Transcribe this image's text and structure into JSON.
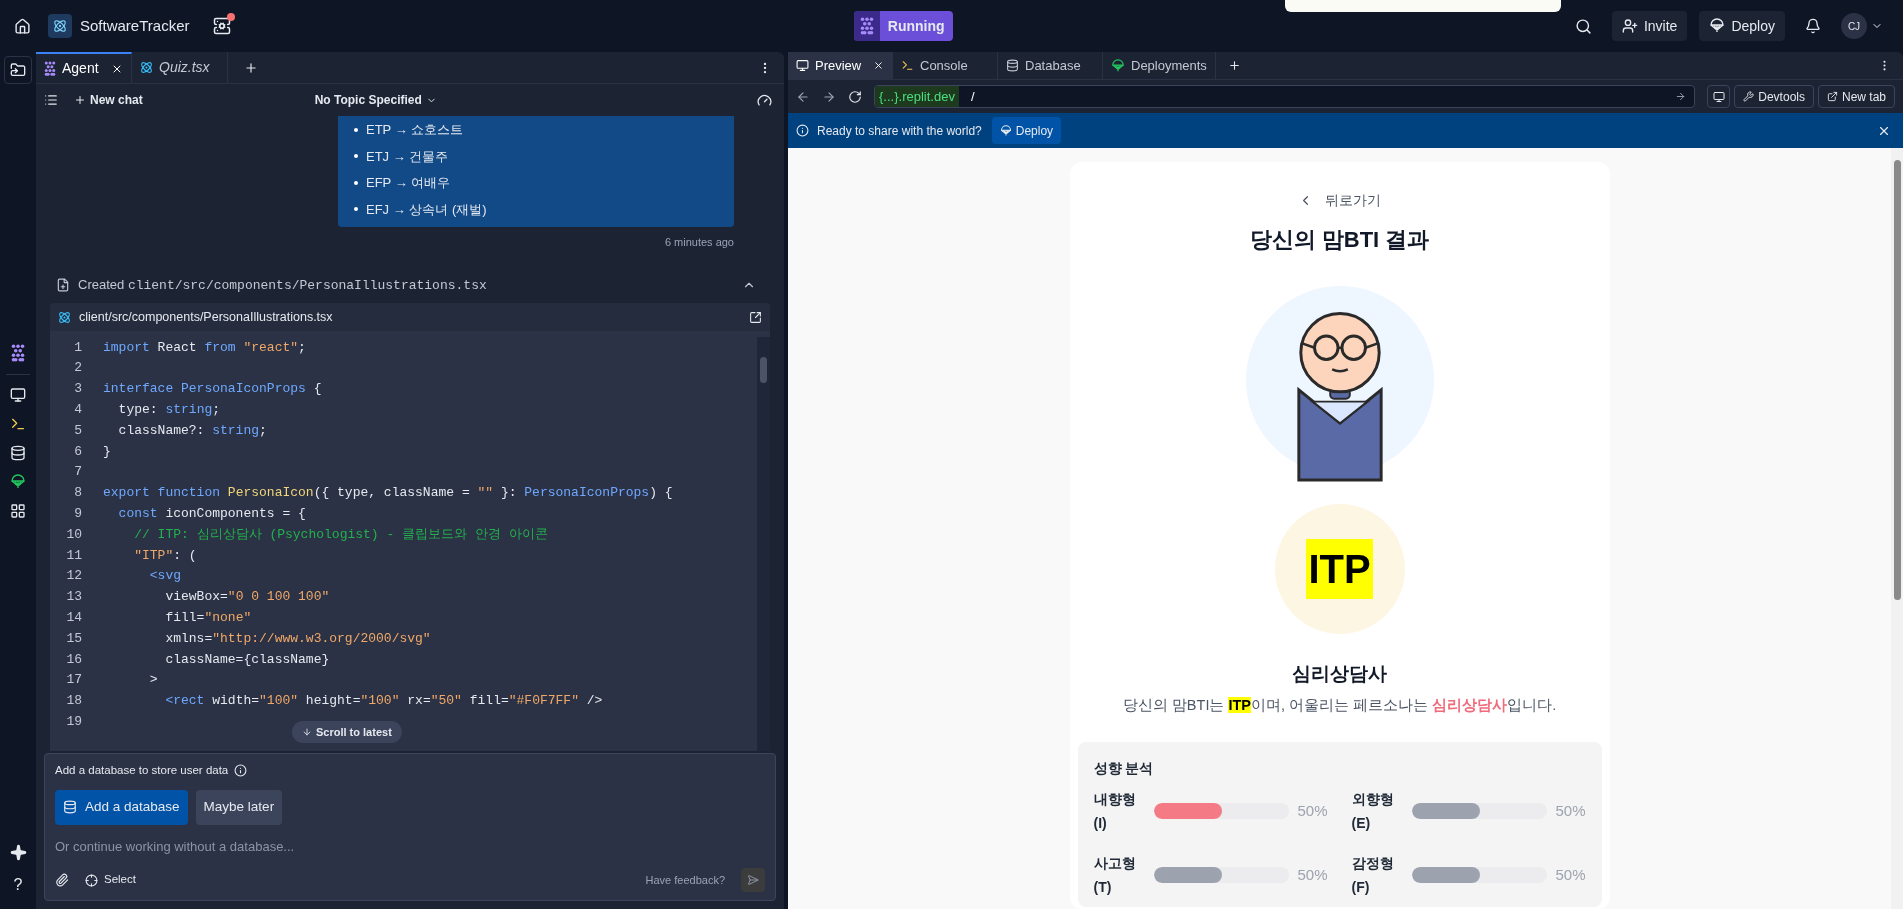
{
  "top_bar": {
    "project_name": "SoftwareTracker",
    "notification_dot": true,
    "status_button": "Running",
    "invite_button": "Invite",
    "deploy_button": "Deploy",
    "avatar": "CJ"
  },
  "left_rail": {
    "help_glyph": "?"
  },
  "agent_panel": {
    "tabs": [
      {
        "label": "Agent",
        "selected": true,
        "closable": true
      },
      {
        "label": "Quiz.tsx",
        "selected": false,
        "closable": false
      }
    ],
    "new_chat": "New chat",
    "topic": "No Topic Specified",
    "message_items": [
      "ETP → 쇼호스트",
      "ETJ → 건물주",
      "EFP → 여배우",
      "EFJ → 상속녀 (재벌)"
    ],
    "message_time": "6 minutes ago",
    "created_label": "Created",
    "created_path": "client/src/components/PersonaIllustrations.tsx",
    "code_file": "client/src/components/PersonaIllustrations.tsx",
    "code_lines": [
      {
        "n": "1",
        "tokens": [
          {
            "t": "import",
            "kind": "kw"
          },
          {
            "t": " React ",
            "kind": "txt"
          },
          {
            "t": "from",
            "kind": "kw"
          },
          {
            "t": " \"react\"",
            "kind": "str"
          },
          {
            "t": ";",
            "kind": "txt"
          }
        ]
      },
      {
        "n": "2"
      },
      {
        "n": "3",
        "tokens": [
          {
            "t": "interface",
            "kind": "kw"
          },
          {
            "t": " PersonaIconProps",
            "kind": "type"
          },
          {
            "t": " {",
            "kind": "txt"
          }
        ]
      },
      {
        "n": "4",
        "tokens": [
          {
            "t": "  type: ",
            "kind": "txt"
          },
          {
            "t": "string",
            "kind": "type"
          },
          {
            "t": ";",
            "kind": "txt"
          }
        ]
      },
      {
        "n": "5",
        "tokens": [
          {
            "t": "  className?: ",
            "kind": "txt"
          },
          {
            "t": "string",
            "kind": "type"
          },
          {
            "t": ";",
            "kind": "txt"
          }
        ]
      },
      {
        "n": "6",
        "tokens": [
          {
            "t": "}",
            "kind": "txt"
          }
        ]
      },
      {
        "n": "7"
      },
      {
        "n": "8",
        "tokens": [
          {
            "t": "export",
            "kind": "kw"
          },
          {
            "t": " function",
            "kind": "kw"
          },
          {
            "t": " PersonaIcon",
            "kind": "fn"
          },
          {
            "t": "({ type, className = ",
            "kind": "txt"
          },
          {
            "t": "\"\"",
            "kind": "str"
          },
          {
            "t": " }: ",
            "kind": "txt"
          },
          {
            "t": "PersonaIconProps",
            "kind": "type"
          },
          {
            "t": ") {",
            "kind": "txt"
          }
        ]
      },
      {
        "n": "9",
        "tokens": [
          {
            "t": "  const",
            "kind": "kw"
          },
          {
            "t": " iconComponents = {",
            "kind": "txt"
          }
        ]
      },
      {
        "n": "10",
        "tokens": [
          {
            "t": "    // ITP: 심리상담사 (Psychologist) - 클립보드와 안경 아이콘",
            "kind": "com"
          }
        ]
      },
      {
        "n": "11",
        "tokens": [
          {
            "t": "    \"ITP\"",
            "kind": "str"
          },
          {
            "t": ": (",
            "kind": "txt"
          }
        ]
      },
      {
        "n": "12",
        "tokens": [
          {
            "t": "      <svg",
            "kind": "tag"
          }
        ]
      },
      {
        "n": "13",
        "tokens": [
          {
            "t": "        viewBox=",
            "kind": "txt"
          },
          {
            "t": "\"0 0 100 100\"",
            "kind": "str"
          }
        ]
      },
      {
        "n": "14",
        "tokens": [
          {
            "t": "        fill=",
            "kind": "txt"
          },
          {
            "t": "\"none\"",
            "kind": "str"
          }
        ]
      },
      {
        "n": "15",
        "tokens": [
          {
            "t": "        xmlns=",
            "kind": "txt"
          },
          {
            "t": "\"http://www.w3.org/2000/svg\"",
            "kind": "str"
          }
        ]
      },
      {
        "n": "16",
        "tokens": [
          {
            "t": "        className={className}",
            "kind": "txt"
          }
        ]
      },
      {
        "n": "17",
        "tokens": [
          {
            "t": "      >",
            "kind": "txt"
          }
        ]
      },
      {
        "n": "18",
        "tokens": [
          {
            "t": "        <rect",
            "kind": "tag"
          },
          {
            "t": " width=",
            "kind": "txt"
          },
          {
            "t": "\"100\"",
            "kind": "str"
          },
          {
            "t": " height=",
            "kind": "txt"
          },
          {
            "t": "\"100\"",
            "kind": "str"
          },
          {
            "t": " rx=",
            "kind": "txt"
          },
          {
            "t": "\"50\"",
            "kind": "str"
          },
          {
            "t": " fill=",
            "kind": "txt"
          },
          {
            "t": "\"#F0F7FF\"",
            "kind": "str"
          },
          {
            "t": " />",
            "kind": "txt"
          }
        ]
      },
      {
        "n": "19"
      }
    ],
    "scroll_button": "Scroll to latest",
    "prompt": {
      "text": "Add a database to store user data",
      "primary": "Add a database",
      "secondary": "Maybe later",
      "placeholder": "Or continue working without a database...",
      "select": "Select",
      "feedback": "Have feedback?"
    }
  },
  "preview_panel": {
    "tabs": [
      {
        "label": "Preview",
        "selected": true,
        "closable": true,
        "kind": "monitor"
      },
      {
        "label": "Console",
        "selected": false,
        "closable": false,
        "kind": "terminal"
      },
      {
        "label": "Database",
        "selected": false,
        "closable": false,
        "kind": "database"
      },
      {
        "label": "Deployments",
        "selected": false,
        "closable": false,
        "kind": "deploy"
      }
    ],
    "url_badge": "{...}.replit.dev",
    "url_path": "/",
    "devtools": "Devtools",
    "new_tab": "New tab",
    "banner": {
      "text": "Ready to share with the world?",
      "button": "Deploy"
    },
    "page": {
      "back": "뒤로가기",
      "title": "당신의 맘BTI 결과",
      "type_code": "ITP",
      "persona": "심리상담사",
      "description": "당신의 맘BTI는 **ITP**이며, 어울리는 페르소나는 **심리상담사**입니다.",
      "traits_title": "성향 분석",
      "traits": [
        {
          "label": "내향형 (I)",
          "level": 0.5,
          "reading": "50%",
          "color": "#f47a85"
        },
        {
          "label": "외향형 (E)",
          "level": 0.5,
          "reading": "50%",
          "color": "#9ca3af"
        },
        {
          "label": "사고형 (T)",
          "level": 0.5,
          "reading": "50%",
          "color": "#9ca3af"
        },
        {
          "label": "감정형 (F)",
          "level": 0.5,
          "reading": "50%",
          "color": "#9ca3af"
        }
      ]
    }
  }
}
